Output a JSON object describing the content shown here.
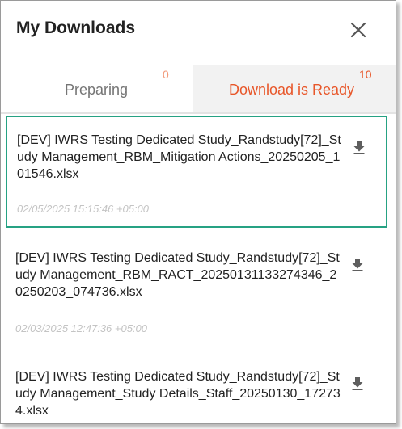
{
  "header": {
    "title": "My Downloads",
    "close_icon": "close-icon"
  },
  "tabs": [
    {
      "label": "Preparing",
      "count": "0",
      "active": false
    },
    {
      "label": "Download is Ready",
      "count": "10",
      "active": true
    }
  ],
  "colors": {
    "accent": "#e8572a",
    "selected_border": "#26a283",
    "date_text": "#c4c4c4"
  },
  "downloads": [
    {
      "name": "[DEV] IWRS Testing Dedicated Study_Randstudy[72]_Study Management_RBM_Mitigation Actions_20250205_101546.xlsx",
      "date": "02/05/2025 15:15:46 +05:00",
      "icon": "download-icon",
      "selected": true
    },
    {
      "name": "[DEV] IWRS Testing Dedicated Study_Randstudy[72]_Study Management_RBM_RACT_20250131133274346_20250203_074736.xlsx",
      "date": "02/03/2025 12:47:36 +05:00",
      "icon": "download-icon",
      "selected": false
    },
    {
      "name": "[DEV] IWRS Testing Dedicated Study_Randstudy[72]_Study Management_Study Details_Staff_20250130_172734.xlsx",
      "date": "",
      "icon": "download-icon",
      "selected": false
    }
  ]
}
